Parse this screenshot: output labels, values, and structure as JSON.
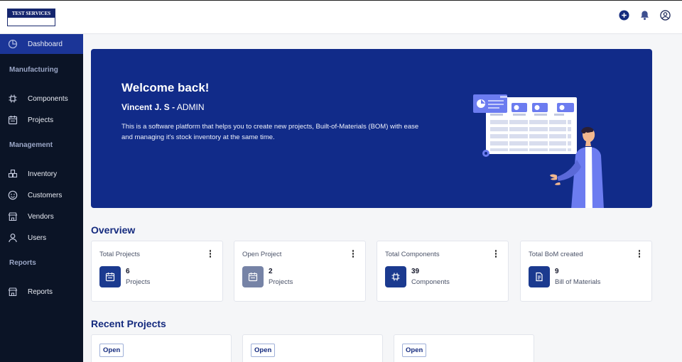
{
  "app": {
    "logo_text": "TEST SERVICES"
  },
  "sidebar": {
    "dashboard": "Dashboard",
    "manufacturing_header": "Manufacturing",
    "components": "Components",
    "projects": "Projects",
    "management_header": "Management",
    "inventory": "Inventory",
    "customers": "Customers",
    "vendors": "Vendors",
    "users": "Users",
    "reports_header": "Reports",
    "reports": "Reports"
  },
  "hero": {
    "title": "Welcome back!",
    "user_name": "Vincent J. S -",
    "user_role": " ADMIN",
    "description": "This is a software platform that helps you to create new projects, Built-of-Materials (BOM) with ease and managing it's stock inventory at the same time."
  },
  "overview": {
    "title": "Overview",
    "cards": [
      {
        "title": "Total Projects",
        "value": "6",
        "unit": "Projects",
        "icon": "calendar-icon",
        "color": "#1b3a8f"
      },
      {
        "title": "Open Project",
        "value": "2",
        "unit": "Projects",
        "icon": "calendar-icon",
        "color": "#7683a6"
      },
      {
        "title": "Total Components",
        "value": "39",
        "unit": "Components",
        "icon": "chip-icon",
        "color": "#1b3a8f"
      },
      {
        "title": "Total BoM created",
        "value": "9",
        "unit": "Bill of Materials",
        "icon": "document-icon",
        "color": "#1b3a8f"
      }
    ]
  },
  "recent": {
    "title": "Recent Projects",
    "items": [
      {
        "status": "Open"
      },
      {
        "status": "Open"
      },
      {
        "status": "Open"
      }
    ]
  },
  "colors": {
    "brand": "#112b89",
    "sidebar": "#0b1426",
    "active": "#1b3597"
  }
}
